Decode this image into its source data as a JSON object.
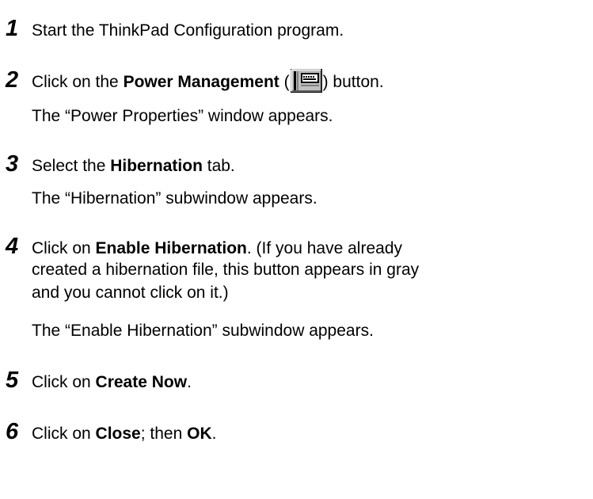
{
  "steps": [
    {
      "number": "1",
      "text": "Start the ThinkPad Configuration program."
    },
    {
      "number": "2",
      "pre": "Click on the ",
      "bold": "Power Management",
      "paren_open": " (",
      "icon": "power-management-icon",
      "paren_close": ") button.",
      "result": "The “Power Properties” window appears."
    },
    {
      "number": "3",
      "pre": "Select the ",
      "bold": "Hibernation",
      "post": " tab.",
      "result": "The “Hibernation” subwindow appears."
    },
    {
      "number": "4",
      "pre": "Click on ",
      "bold": "Enable Hibernation",
      "post": ".  (If you have already",
      "line2": "created a hibernation file, this button appears in gray",
      "line3": "and you cannot click on it.)",
      "result": "The “Enable Hibernation” subwindow appears."
    },
    {
      "number": "5",
      "pre": "Click on ",
      "bold": "Create Now",
      "post": "."
    },
    {
      "number": "6",
      "pre": "Click on ",
      "bold": "Close",
      "mid": "; then ",
      "bold2": "OK",
      "post": "."
    }
  ]
}
